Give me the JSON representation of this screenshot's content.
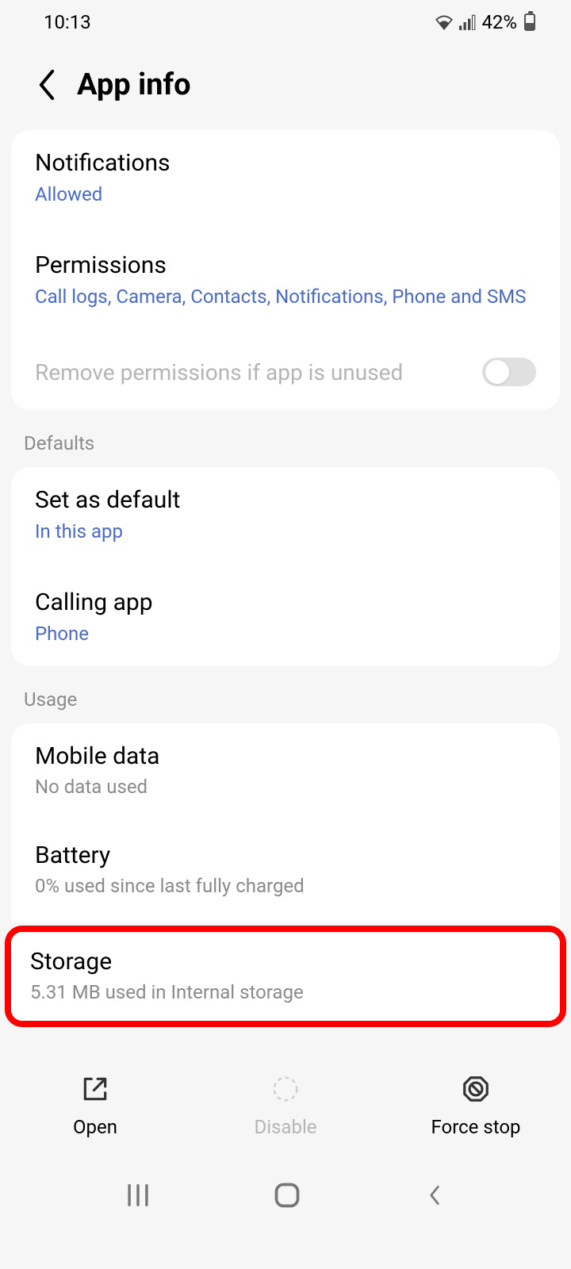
{
  "status_bar": {
    "time": "10:13",
    "battery": "42%"
  },
  "header": {
    "title": "App info"
  },
  "sections": {
    "notifications": {
      "title": "Notifications",
      "value": "Allowed"
    },
    "permissions": {
      "title": "Permissions",
      "value": "Call logs, Camera, Contacts, Notifications, Phone and SMS"
    },
    "remove_permissions": {
      "label": "Remove permissions if app is unused"
    },
    "defaults_header": "Defaults",
    "set_default": {
      "title": "Set as default",
      "value": "In this app"
    },
    "calling_app": {
      "title": "Calling app",
      "value": "Phone"
    },
    "usage_header": "Usage",
    "mobile_data": {
      "title": "Mobile data",
      "value": "No data used"
    },
    "battery": {
      "title": "Battery",
      "value": "0% used since last fully charged"
    },
    "storage": {
      "title": "Storage",
      "value": "5.31 MB used in Internal storage"
    }
  },
  "actions": {
    "open": "Open",
    "disable": "Disable",
    "force_stop": "Force stop"
  }
}
